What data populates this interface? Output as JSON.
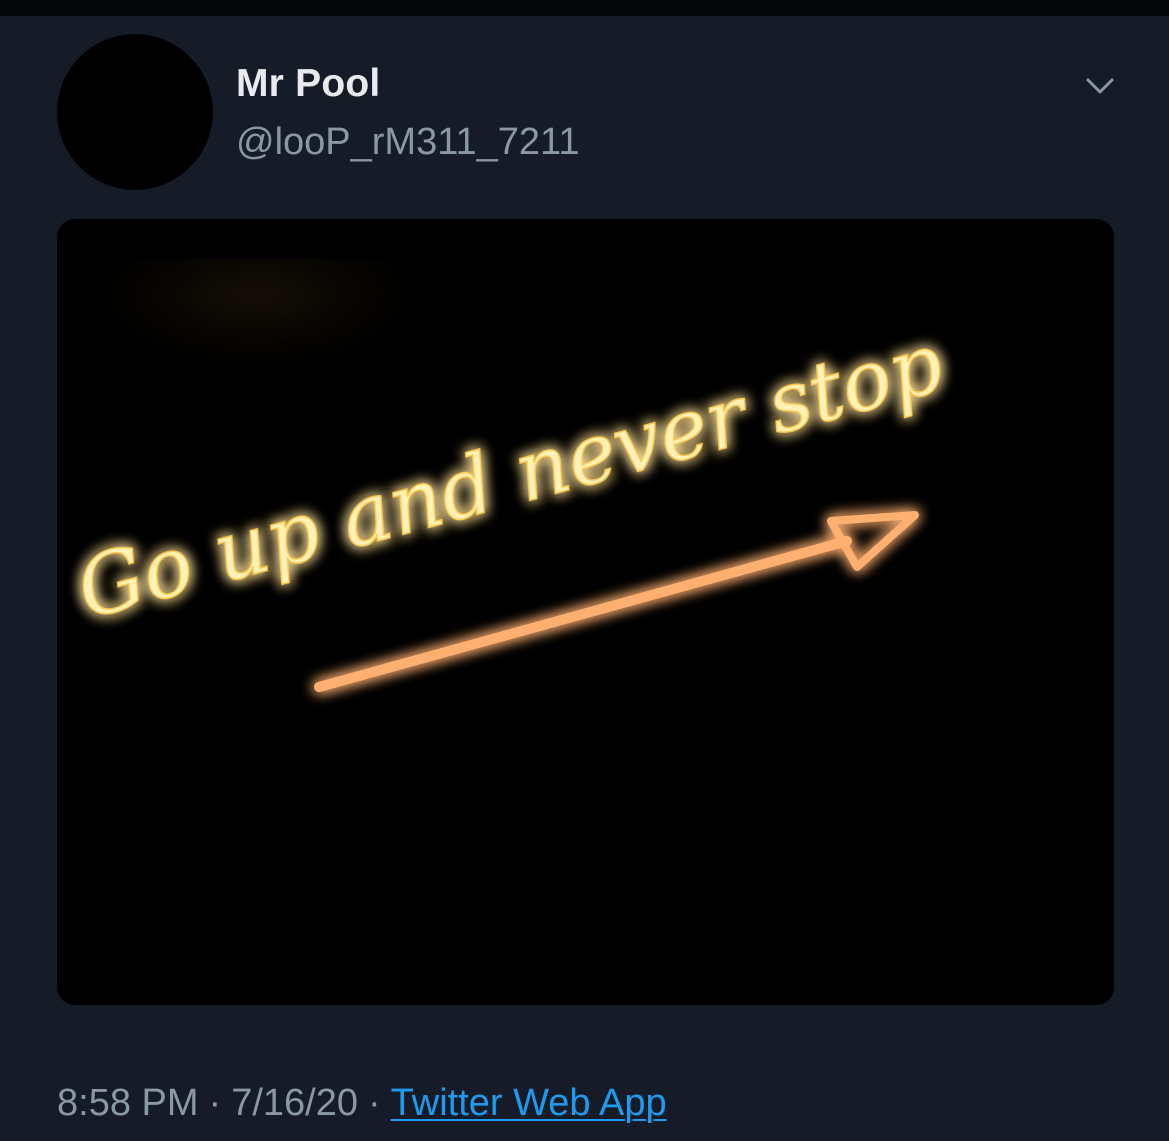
{
  "tweet": {
    "display_name": "Mr Pool",
    "handle": "@looP_rM311_7211",
    "time": "8:58 PM",
    "date": "7/16/20",
    "separator": "·",
    "source": "Twitter Web App"
  },
  "media": {
    "sign_text": "Go up and never stop"
  },
  "icons": {
    "menu": "chevron-down-icon"
  },
  "colors": {
    "background": "#161c27",
    "link": "#1d9bf0",
    "neon_text": "#ffd76a",
    "neon_arrow": "#ff9a52"
  }
}
